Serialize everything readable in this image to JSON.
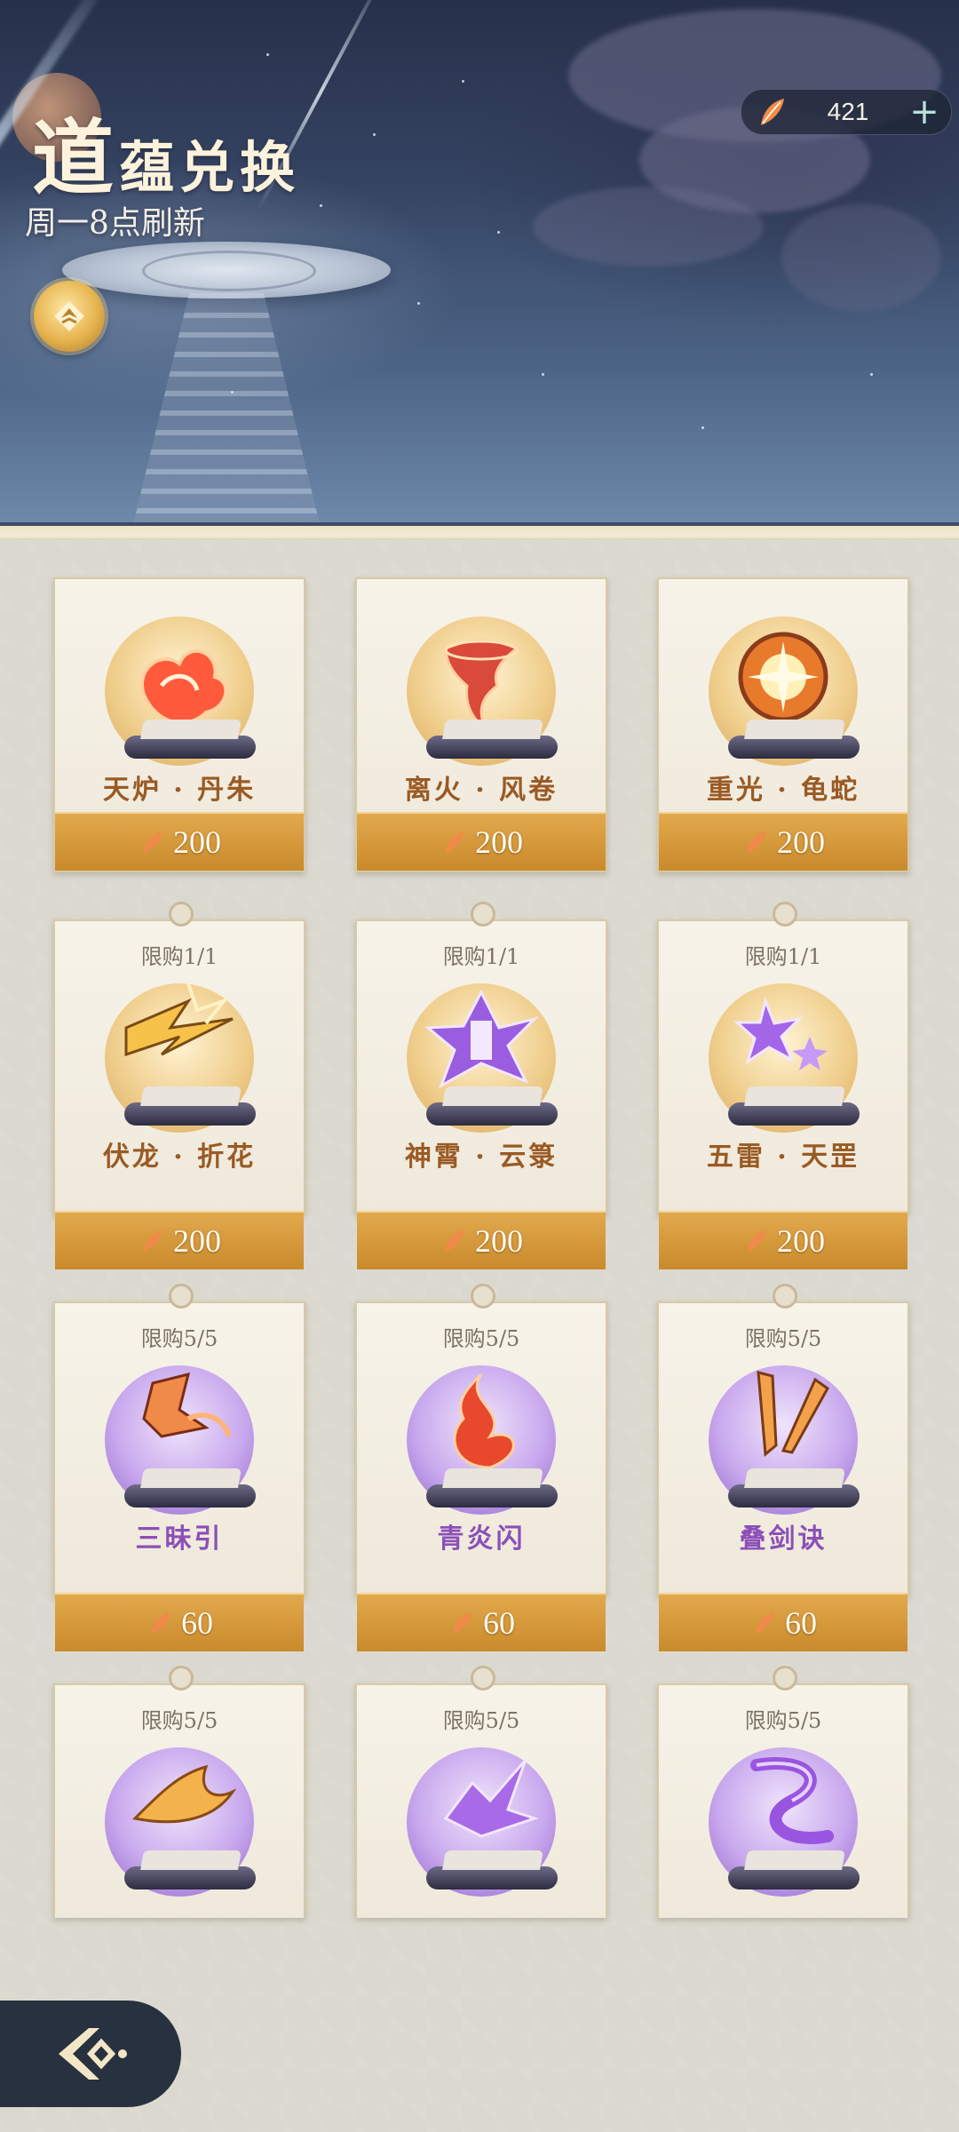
{
  "header": {
    "title_big_char": "道",
    "title_rest": "蕴兑换",
    "subtitle": "周一8点刷新"
  },
  "currency": {
    "icon": "feather-icon",
    "amount": "421",
    "plus_label": "+"
  },
  "items": [
    {
      "name": "天炉 · 丹朱",
      "price": "200",
      "limit": "",
      "theme": "gold",
      "effect": "red-flame"
    },
    {
      "name": "离火 · 风卷",
      "price": "200",
      "limit": "",
      "theme": "gold",
      "effect": "fire-tornado"
    },
    {
      "name": "重光 · 龟蛇",
      "price": "200",
      "limit": "",
      "theme": "gold",
      "effect": "golden-burst"
    },
    {
      "name": "伏龙 · 折花",
      "price": "200",
      "limit": "限购1/1",
      "theme": "gold",
      "effect": "lightning-gold"
    },
    {
      "name": "神霄 · 云箓",
      "price": "200",
      "limit": "限购1/1",
      "theme": "gold",
      "effect": "purple-talisman"
    },
    {
      "name": "五雷 · 天罡",
      "price": "200",
      "limit": "限购1/1",
      "theme": "gold",
      "effect": "purple-stars"
    },
    {
      "name": "三昧引",
      "price": "60",
      "limit": "限购5/5",
      "theme": "purple",
      "effect": "flame-hand"
    },
    {
      "name": "青炎闪",
      "price": "60",
      "limit": "限购5/5",
      "theme": "purple",
      "effect": "red-fire"
    },
    {
      "name": "叠剑诀",
      "price": "60",
      "limit": "限购5/5",
      "theme": "purple",
      "effect": "twin-swords"
    },
    {
      "name": "",
      "price": "",
      "limit": "限购5/5",
      "theme": "purple",
      "effect": "phoenix"
    },
    {
      "name": "",
      "price": "",
      "limit": "限购5/5",
      "theme": "purple",
      "effect": "purple-shards"
    },
    {
      "name": "",
      "price": "",
      "limit": "限购5/5",
      "theme": "purple",
      "effect": "purple-ribbon"
    }
  ],
  "back_button": {
    "icon": "back-arrow-icon"
  }
}
